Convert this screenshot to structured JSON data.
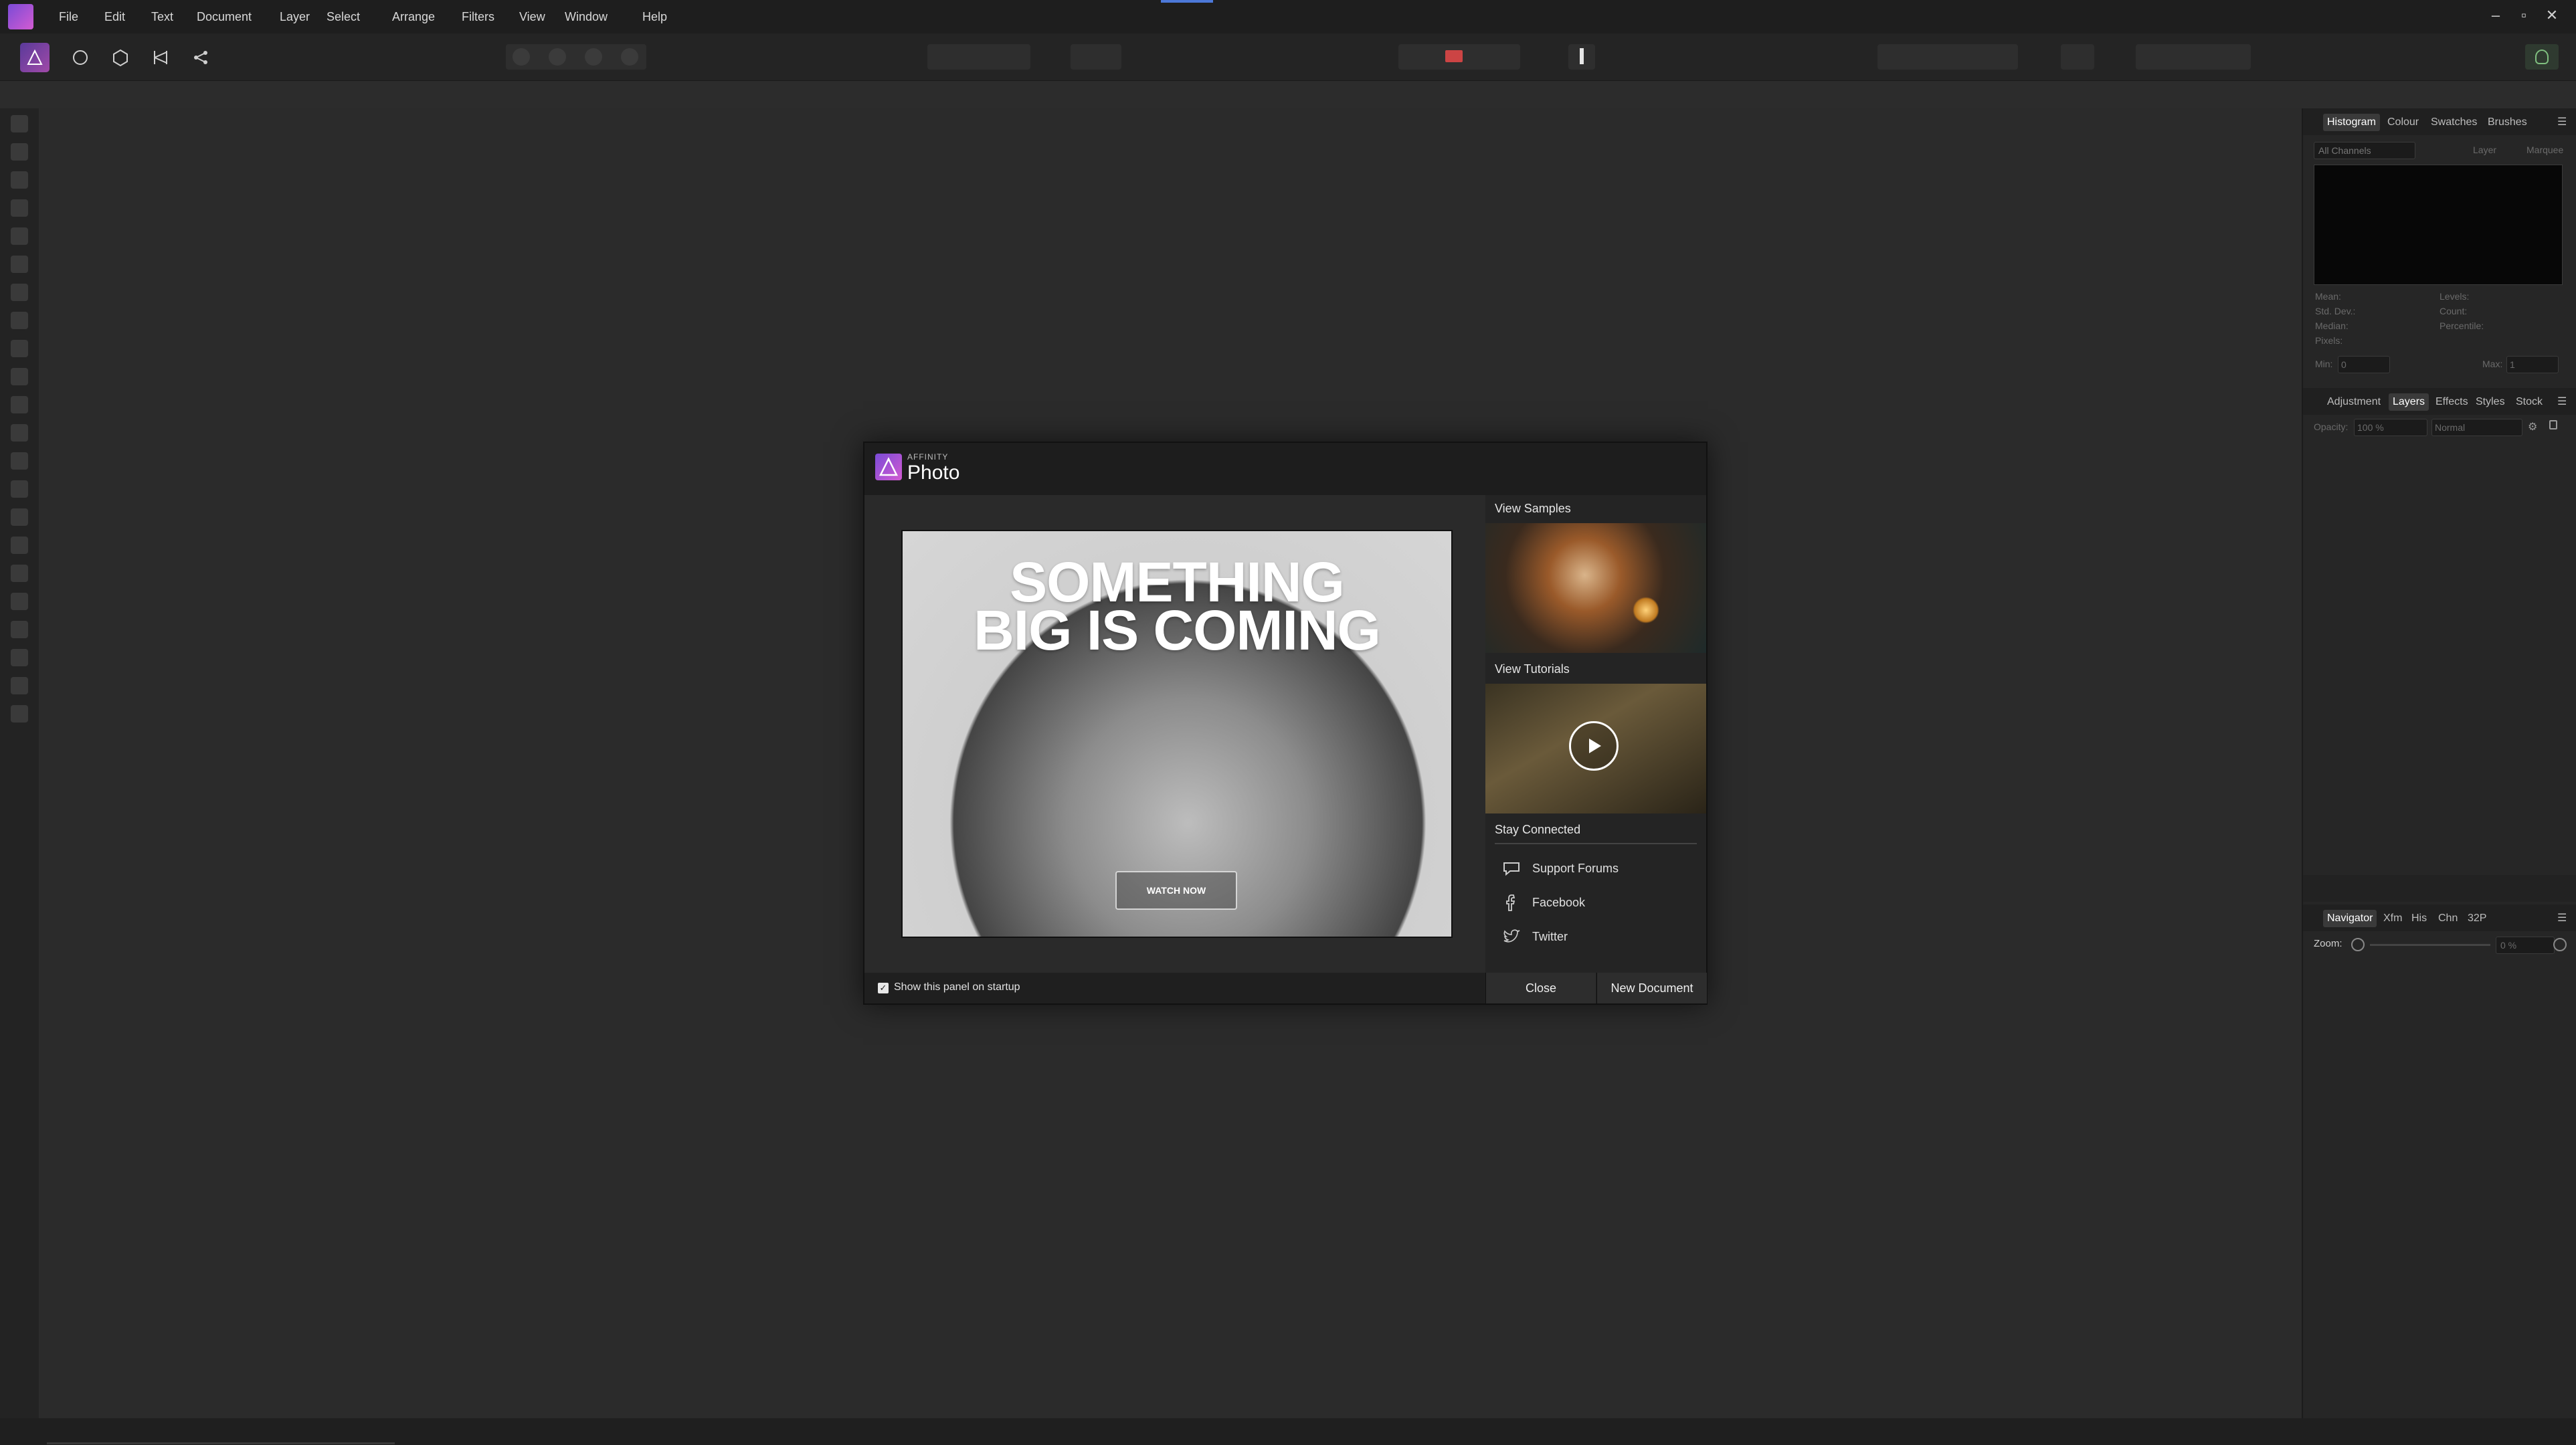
{
  "app": {
    "menu": [
      "File",
      "Edit",
      "Text",
      "Document",
      "Layer",
      "Select",
      "Arrange",
      "Filters",
      "View",
      "Window",
      "Help"
    ],
    "window_controls": [
      "–",
      "▫",
      "✕"
    ]
  },
  "colors": {
    "accent": "#4c78d8",
    "brand_a": "#7a4bd6",
    "brand_b": "#d35bd2"
  },
  "top_panel": {
    "tabs": [
      "Histogram",
      "Colour",
      "Swatches",
      "Brushes"
    ],
    "active_tab": "Histogram",
    "channels": "All Channels",
    "layer_label": "Layer",
    "marquee_label": "Marquee",
    "stats": [
      "Mean:",
      "Std. Dev.:",
      "Median:",
      "Pixels:",
      "Levels:",
      "Count:",
      "Percentile:"
    ],
    "min_label": "Min:",
    "min_value": "0",
    "max_label": "Max:",
    "max_value": "1"
  },
  "mid_panel": {
    "tabs": [
      "Adjustment",
      "Layers",
      "Effects",
      "Styles",
      "Stock"
    ],
    "active_tab": "Layers",
    "opacity_label": "Opacity:",
    "opacity_value": "100 %",
    "blend_mode": "Normal"
  },
  "bottom_panel": {
    "tabs": [
      "Navigator",
      "Xfm",
      "His",
      "Chn",
      "32P"
    ],
    "active_tab": "Navigator",
    "zoom_label": "Zoom:",
    "zoom_value": "0 %"
  },
  "dialog": {
    "brand_small": "AFFINITY",
    "brand_large": "Photo",
    "hero_title_line1": "SOMETHING",
    "hero_title_line2": "BIG IS COMING",
    "watch_now": "WATCH NOW",
    "view_samples": "View Samples",
    "view_tutorials": "View Tutorials",
    "stay_connected": "Stay Connected",
    "links": [
      "Support Forums",
      "Facebook",
      "Twitter"
    ],
    "show_on_startup": "Show this panel on startup",
    "show_on_startup_checked": true,
    "close": "Close",
    "new_document": "New Document"
  }
}
